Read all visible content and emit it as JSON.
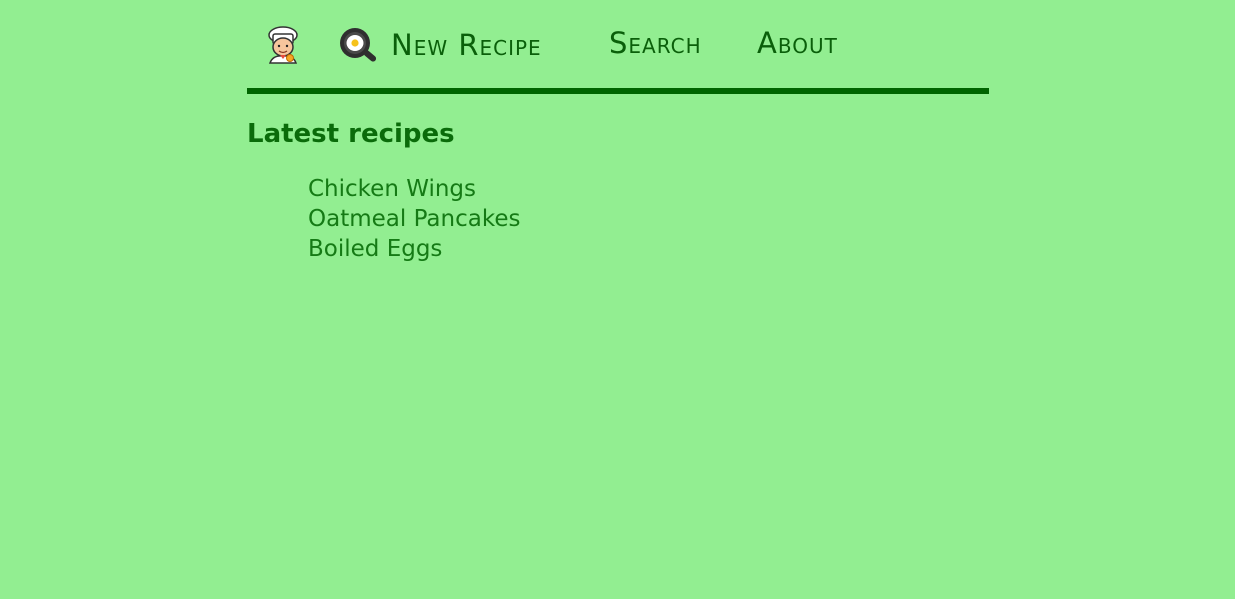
{
  "nav": {
    "home_icon": "chef-icon",
    "new_recipe": {
      "icon": "frying-pan-egg-icon",
      "label": "New Recipe"
    },
    "search_label": "Search",
    "about_label": "About"
  },
  "main": {
    "heading": "Latest recipes",
    "recipes": [
      "Chicken Wings",
      "Oatmeal Pancakes",
      "Boiled Eggs"
    ]
  },
  "colors": {
    "background": "#92ee91",
    "text": "#0a6b0a",
    "rule": "#006400"
  }
}
